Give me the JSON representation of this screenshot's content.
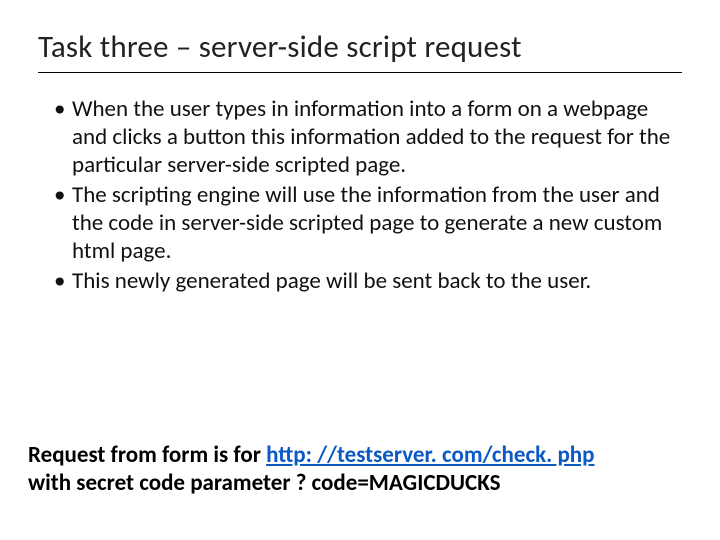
{
  "title": "Task three – server-side script request",
  "bullets": [
    "When the user types in information into a form on a webpage and clicks a button this information added to the request for the particular server-side scripted page.",
    "The scripting engine will use the information from the user and the code in server-side scripted page to generate a new custom html page.",
    "This newly generated page will be sent back to the user."
  ],
  "footer": {
    "prefix": "Request from form is for ",
    "url": "http: //testserver. com/check. php",
    "suffix_line": "with secret code parameter ? code=MAGICDUCKS"
  }
}
